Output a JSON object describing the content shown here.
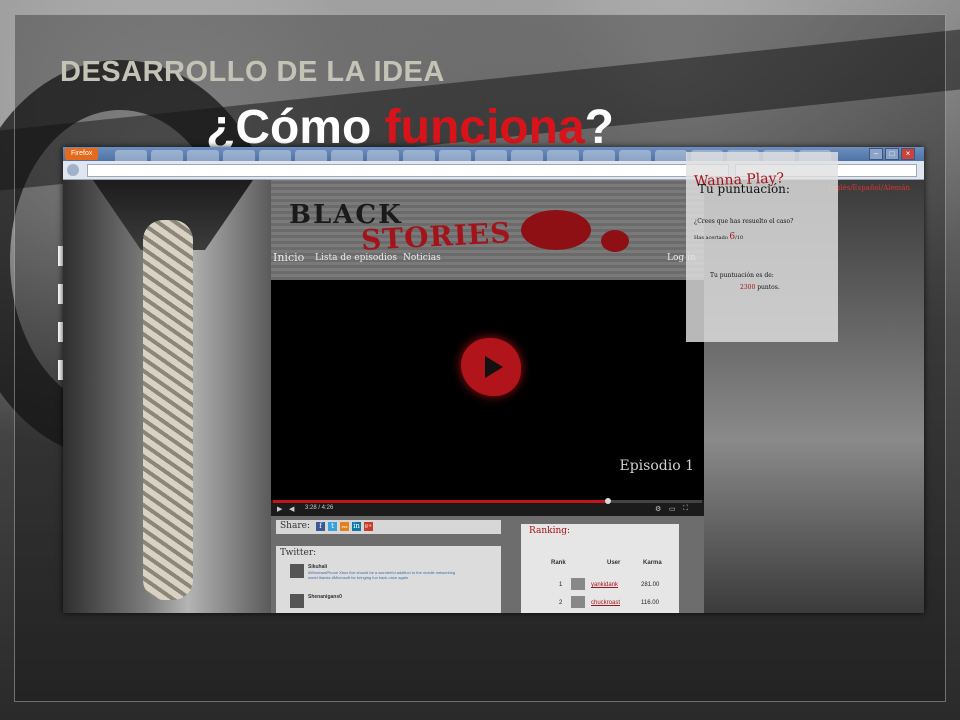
{
  "slide": {
    "title": "DESARROLLO DE LA IDEA",
    "heading_prefix": "¿Cómo ",
    "heading_accent": "funciona",
    "heading_suffix": "?",
    "accent_color": "#d8141a",
    "title_color": "#c5c3b6",
    "bullet_count": 4
  },
  "browser": {
    "firefox_label": "Firefox",
    "window_controls": [
      "–",
      "□",
      "×"
    ]
  },
  "site": {
    "logo_part1": "BLACK",
    "logo_part2": "STORIES",
    "languages": "Inglés/Español/Alemán",
    "nav": {
      "home": "Inicio",
      "episodes": "Lista de episodios",
      "news": "Noticias",
      "login": "Log in"
    },
    "video": {
      "episode_title": "Episodio 1",
      "time": "3:28 / 4:26",
      "progress_fraction": 0.78
    },
    "share": {
      "label": "Share:",
      "icons": [
        "f",
        "t",
        "rss",
        "in",
        "g+"
      ]
    },
    "twitter": {
      "title": "Twitter:",
      "tweets": [
        {
          "user": "Sikuhali",
          "text": "#WindowsPhone Xbox live should be a wonderful addition to the mobile networking world thanks #Microsoft for bringing fun back once again"
        },
        {
          "user": "Shenanigans0",
          "text": ""
        }
      ]
    },
    "ranking": {
      "title": "Ranking:",
      "headers": [
        "Rank",
        "User",
        "Karma"
      ],
      "rows": [
        {
          "rank": "1",
          "user": "yankidank",
          "karma": "281.00"
        },
        {
          "rank": "2",
          "user": "chuckroast",
          "karma": "116.00"
        }
      ]
    },
    "game": {
      "wanna_play": "Wanna Play?",
      "score_title": "Tu puntuación:",
      "question": "¿Crees que has resuelto el caso?",
      "acertado_prefix": "Has acertado ",
      "acertado_value": "6",
      "acertado_suffix": "/10",
      "total_label": "Tu puntuación es de:",
      "points_value": "2300",
      "points_suffix": " puntos."
    }
  }
}
